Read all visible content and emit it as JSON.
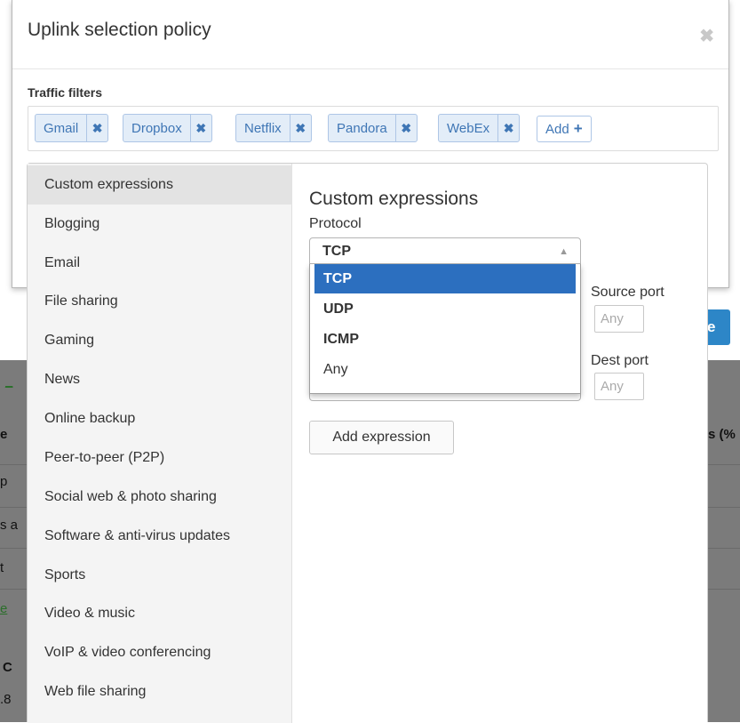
{
  "modal": {
    "title": "Uplink selection policy",
    "close_glyph": "✖",
    "filters_label": "Traffic filters",
    "tags": [
      {
        "label": "Gmail",
        "remove": "✖"
      },
      {
        "label": "Dropbox",
        "remove": "✖"
      },
      {
        "label": "Netflix",
        "remove": "✖"
      },
      {
        "label": "Pandora",
        "remove": "✖"
      },
      {
        "label": "WebEx",
        "remove": "✖"
      }
    ],
    "add_label": "Add",
    "add_glyph": "+"
  },
  "categories": [
    "Custom expressions",
    "Blogging",
    "Email",
    "File sharing",
    "Gaming",
    "News",
    "Online backup",
    "Peer-to-peer (P2P)",
    "Social web & photo sharing",
    "Software & anti-virus updates",
    "Sports",
    "Video & music",
    "VoIP & video conferencing",
    "Web file sharing"
  ],
  "active_category": "Custom expressions",
  "custom": {
    "title": "Custom expressions",
    "protocol_label": "Protocol",
    "protocol_value": "TCP",
    "select_arrow": "▲",
    "options": [
      "TCP",
      "UDP",
      "ICMP",
      "Any"
    ],
    "source_port_label": "Source port",
    "source_port_placeholder": "Any",
    "dest_port_label": "Dest port",
    "dest_port_placeholder": "Any",
    "add_expression_label": "Add expression"
  },
  "background": {
    "save_fragment": "e",
    "frag_e": "e",
    "frag_pct": "s (%",
    "frag_p": "p",
    "frag_sa": "s a",
    "frag_t": "t",
    "frag_e2": "e",
    "frag_c": "C",
    "frag_8": ".8"
  },
  "colors": {
    "tag_bg": "#e3edf8",
    "tag_text": "#3f76b5",
    "selected_option": "#2c6fbf",
    "dim_overlay": "#7b7b7b",
    "save_button": "#2d86c7"
  }
}
